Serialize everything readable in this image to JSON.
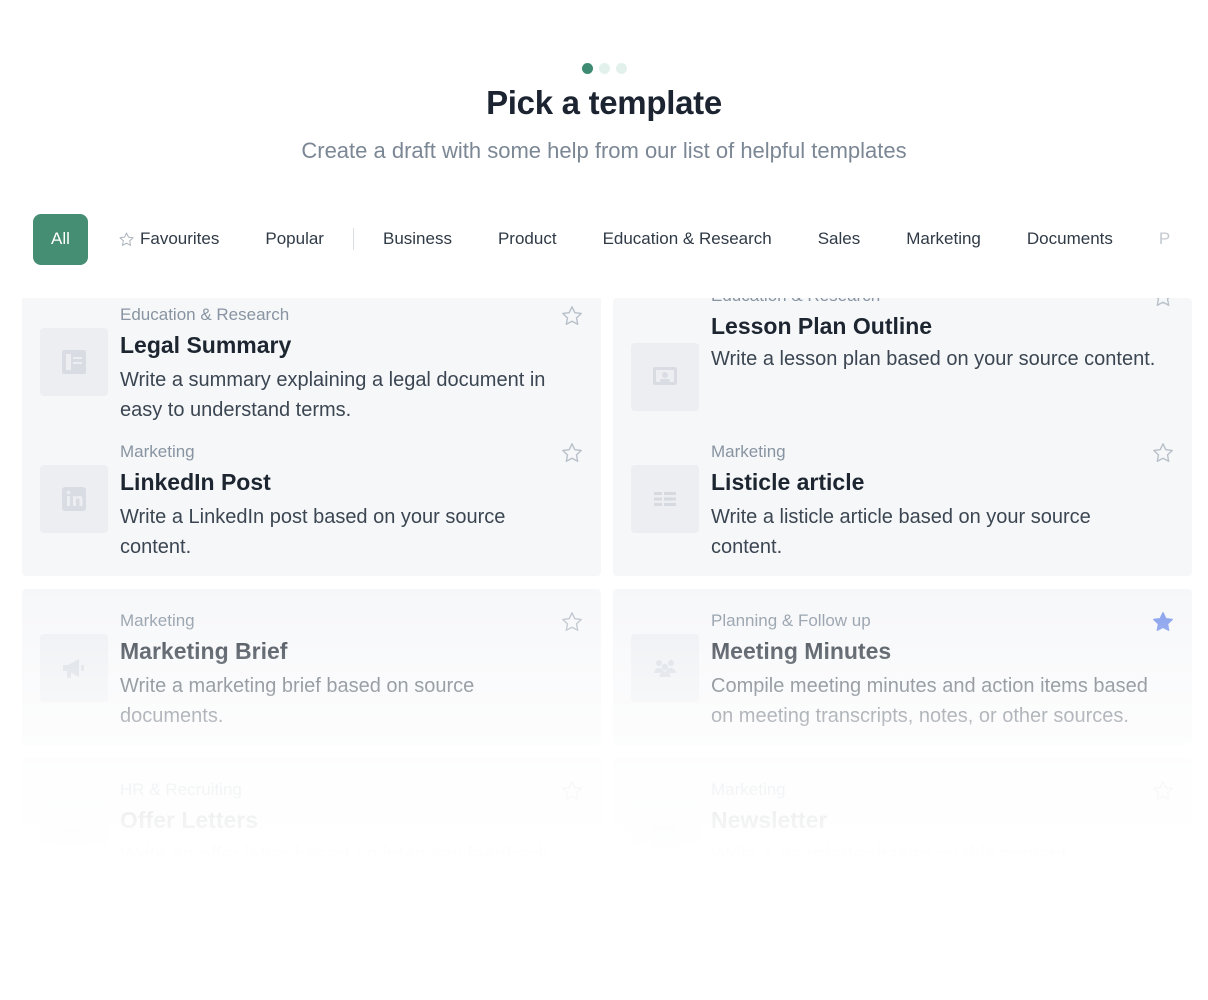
{
  "header": {
    "title": "Pick a template",
    "subtitle": "Create a draft with some help from our list of helpful templates"
  },
  "stepper": {
    "total_steps": 3,
    "current_step": 1
  },
  "filters": {
    "all": "All",
    "favourites": "Favourites",
    "popular": "Popular",
    "business": "Business",
    "product": "Product",
    "education": "Education & Research",
    "sales": "Sales",
    "marketing": "Marketing",
    "documents": "Documents",
    "next_partial": "P"
  },
  "templates": [
    {
      "category": "Education & Research",
      "title": "Legal Summary",
      "description": "Write a summary explaining a legal document in easy to understand terms.",
      "icon": "document-icon",
      "favourited": false
    },
    {
      "category": "Education & Research",
      "title": "Lesson Plan Outline",
      "description": "Write a lesson plan based on your source content.",
      "icon": "presentation-icon",
      "favourited": false
    },
    {
      "category": "Marketing",
      "title": "LinkedIn Post",
      "description": "Write a LinkedIn post based on your source content.",
      "icon": "linkedin-icon",
      "favourited": false
    },
    {
      "category": "Marketing",
      "title": "Listicle article",
      "description": "Write a listicle article based on your source content.",
      "icon": "list-icon",
      "favourited": false
    },
    {
      "category": "Marketing",
      "title": "Marketing Brief",
      "description": "Write a marketing brief based on source documents.",
      "icon": "megaphone-icon",
      "favourited": false
    },
    {
      "category": "Planning & Follow up",
      "title": "Meeting Minutes",
      "description": "Compile meeting minutes and action items based on meeting transcripts, notes, or other sources.",
      "icon": "meeting-icon",
      "favourited": true
    },
    {
      "category": "HR & Recruiting",
      "title": "Offer Letters",
      "description": "Write an offer letter based on interview feedback.",
      "icon": "letter-icon",
      "favourited": false
    },
    {
      "category": "Marketing",
      "title": "Newsletter",
      "description": "Write a newsletter based on this content.",
      "icon": "newsletter-icon",
      "favourited": false
    }
  ],
  "colors": {
    "accent": "#458e73",
    "favourite_star": "#7b96ea",
    "card_background": "#f6f7f9"
  }
}
